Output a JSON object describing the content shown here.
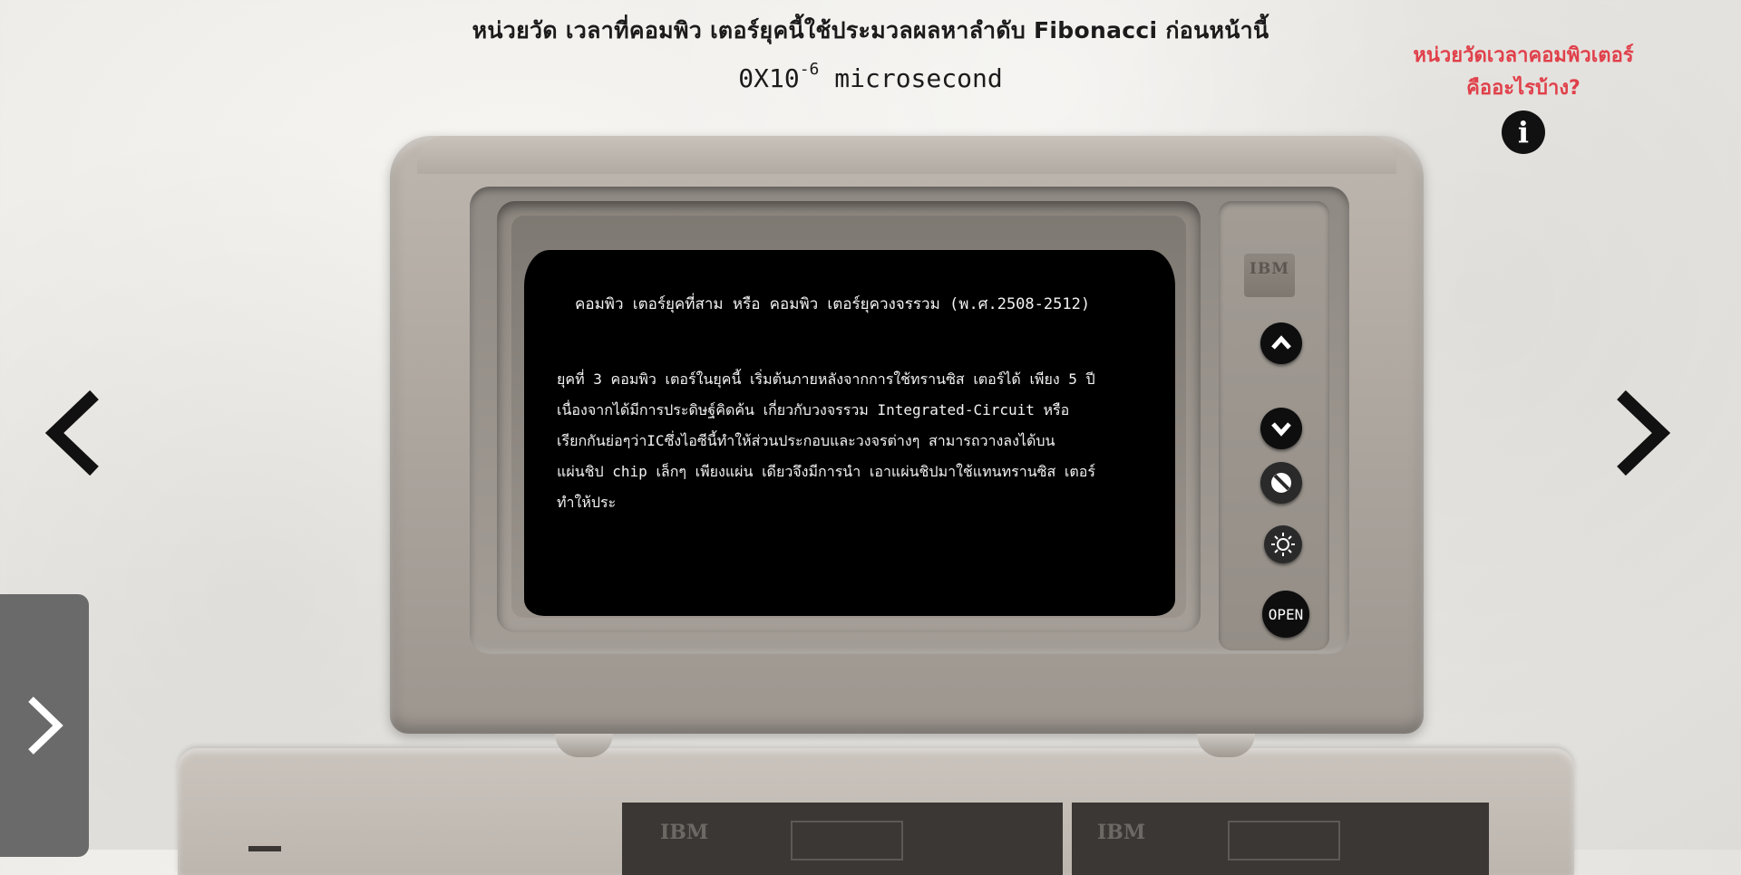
{
  "heading": {
    "title": "หน่วยวัด เวลาที่คอมพิว เตอร์ยุคนี้ใช้ประมวลผลหาลำดับ Fibonacci ก่อนหน้านี้",
    "measure_value": "0X10",
    "measure_exponent": "-6",
    "measure_unit": " microsecond"
  },
  "info_link": {
    "line1": "หน่วยวัดเวลาคอมพิวเตอร์",
    "line2": "คืออะไรบ้าง?",
    "icon_glyph": "i"
  },
  "screen": {
    "title": "คอมพิว เตอร์ยุคที่สาม หรือ คอมพิว เตอร์ยุควงจรรวม (พ.ศ.2508-2512)",
    "body": "ยุคที่ 3 คอมพิว เตอร์ในยุคนี้ เริ่มต้นภายหลังจากการใช้ทรานซิส เตอร์ได้ เพียง 5 ปี\nเนื่องจากได้มีการประดิษฐ์คิดค้น เกี่ยวกับวงจรรวม Integrated-Circuit หรือ\nเรียกกันย่อๆว่าICซึ่งไอซีนี้ทำให้ส่วนประกอบและวงจรต่างๆ สามารถวางลงได้บน\nแผ่นชิป chip เล็กๆ เพียงแผ่น เดียวจึงมีการนำ เอาแผ่นชิปมาใช้แทนทรานซิส เตอร์\nทำให้ประ"
  },
  "controls": {
    "open_label": "OPEN",
    "brand": "IBM"
  },
  "base": {
    "bay1_brand": "IBM",
    "bay2_brand": "IBM"
  },
  "colors": {
    "accent_red": "#e0404a",
    "screen_bg": "#000000",
    "drawer_bg": "#6a6a6a"
  },
  "icons": {
    "prev": "chevron-left-icon",
    "next": "chevron-right-icon",
    "drawer": "chevron-right-icon",
    "up": "chevron-up-icon",
    "down": "chevron-down-icon",
    "contrast": "contrast-icon",
    "brightness": "sun-icon",
    "info": "info-icon"
  }
}
